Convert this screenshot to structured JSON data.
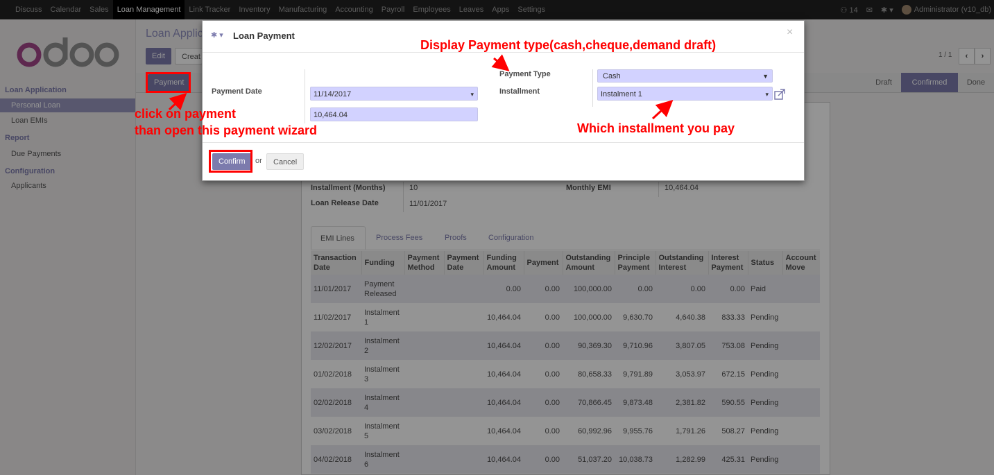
{
  "topnav": {
    "items": [
      "Discuss",
      "Calendar",
      "Sales",
      "Loan Management",
      "Link Tracker",
      "Inventory",
      "Manufacturing",
      "Accounting",
      "Payroll",
      "Employees",
      "Leaves",
      "Apps",
      "Settings"
    ],
    "active_index": 3,
    "notification_count": "14",
    "user": "Administrator (v10_db)"
  },
  "sidebar": {
    "logo_text": "odoo",
    "sections": [
      {
        "title": "Loan Application",
        "items": [
          "Personal Loan",
          "Loan EMIs"
        ]
      },
      {
        "title": "Report",
        "items": [
          "Due Payments"
        ]
      },
      {
        "title": "Configuration",
        "items": [
          "Applicants"
        ]
      }
    ]
  },
  "control_panel": {
    "title": "Loan Applic",
    "edit_label": "Edit",
    "create_label": "Creat",
    "pager": "1 / 1"
  },
  "header": {
    "payment_label": "Payment",
    "statuses": [
      "Draft",
      "Confirmed",
      "Done"
    ],
    "active_status": "Confirmed"
  },
  "form": {
    "installment_months_label": "Installment (Months)",
    "installment_months_value": "10",
    "release_date_label": "Loan Release Date",
    "release_date_value": "11/01/2017",
    "monthly_emi_label": "Monthly EMI",
    "monthly_emi_value": "10,464.04"
  },
  "tabs": [
    "EMI Lines",
    "Process Fees",
    "Proofs",
    "Configuration"
  ],
  "emi_table": {
    "headers": [
      "Transaction Date",
      "Funding",
      "Payment Method",
      "Payment Date",
      "Funding Amount",
      "Payment",
      "Outstanding Amount",
      "Principle Payment",
      "Outstanding Interest",
      "Interest Payment",
      "Status",
      "Account Move"
    ],
    "rows": [
      [
        "11/01/2017",
        "Payment Released",
        "",
        "",
        "0.00",
        "0.00",
        "100,000.00",
        "0.00",
        "0.00",
        "0.00",
        "Paid",
        ""
      ],
      [
        "11/02/2017",
        "Instalment 1",
        "",
        "",
        "10,464.04",
        "0.00",
        "100,000.00",
        "9,630.70",
        "4,640.38",
        "833.33",
        "Pending",
        ""
      ],
      [
        "12/02/2017",
        "Instalment 2",
        "",
        "",
        "10,464.04",
        "0.00",
        "90,369.30",
        "9,710.96",
        "3,807.05",
        "753.08",
        "Pending",
        ""
      ],
      [
        "01/02/2018",
        "Instalment 3",
        "",
        "",
        "10,464.04",
        "0.00",
        "80,658.33",
        "9,791.89",
        "3,053.97",
        "672.15",
        "Pending",
        ""
      ],
      [
        "02/02/2018",
        "Instalment 4",
        "",
        "",
        "10,464.04",
        "0.00",
        "70,866.45",
        "9,873.48",
        "2,381.82",
        "590.55",
        "Pending",
        ""
      ],
      [
        "03/02/2018",
        "Instalment 5",
        "",
        "",
        "10,464.04",
        "0.00",
        "60,992.96",
        "9,955.76",
        "1,791.26",
        "508.27",
        "Pending",
        ""
      ],
      [
        "04/02/2018",
        "Instalment 6",
        "",
        "",
        "10,464.04",
        "0.00",
        "51,037.20",
        "10,038.73",
        "1,282.99",
        "425.31",
        "Pending",
        ""
      ]
    ]
  },
  "modal": {
    "title": "Loan Payment",
    "payment_date_label": "Payment Date",
    "payment_date_value": "11/14/2017",
    "amount_value": "10,464.04",
    "payment_type_label": "Payment Type",
    "payment_type_value": "Cash",
    "installment_label": "Installment",
    "installment_value": "Instalment 1",
    "close_glyph": "×",
    "confirm_label": "Confirm",
    "or_label": "or",
    "cancel_label": "Cancel"
  },
  "annotations": {
    "payment_type_note": "Display Payment type(cash,cheque,demand draft)",
    "click_note_1": "click on payment",
    "click_note_2": "than open this payment wizard",
    "installment_note": "Which installment you pay"
  },
  "colors": {
    "brand": "#7c7bad",
    "annotation": "#ff0000",
    "input_bg": "#d2d2ff"
  }
}
